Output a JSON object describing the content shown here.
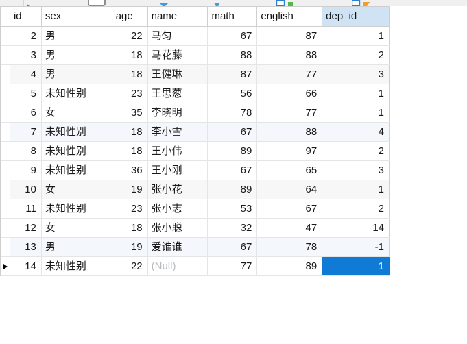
{
  "toolbar": {
    "icons": [
      {
        "name": "run-query-icon",
        "glyph": "▶"
      },
      {
        "name": "stop-icon",
        "glyph": "□"
      },
      {
        "name": "explain-icon",
        "glyph": "▸"
      },
      {
        "name": "filter-icon",
        "glyph": "▼"
      },
      {
        "name": "export-icon",
        "glyph": "▤"
      },
      {
        "name": "import-icon",
        "glyph": "▥"
      }
    ]
  },
  "grid": {
    "columns": [
      {
        "key": "id",
        "label": "id",
        "align": "num"
      },
      {
        "key": "sex",
        "label": "sex",
        "align": "txt"
      },
      {
        "key": "age",
        "label": "age",
        "align": "num"
      },
      {
        "key": "name",
        "label": "name",
        "align": "txt"
      },
      {
        "key": "math",
        "label": "math",
        "align": "num"
      },
      {
        "key": "english",
        "label": "english",
        "align": "num"
      },
      {
        "key": "dep_id",
        "label": "dep_id",
        "align": "num"
      }
    ],
    "selected_column": "dep_id",
    "selected_cell": {
      "row": 12,
      "column": "dep_id",
      "value": "1"
    },
    "current_row_index": 12,
    "null_text": "(Null)",
    "rows": [
      {
        "id": "2",
        "sex": "男",
        "age": "22",
        "name": "马匀",
        "math": "67",
        "english": "87",
        "dep_id": "1"
      },
      {
        "id": "3",
        "sex": "男",
        "age": "18",
        "name": "马花藤",
        "math": "88",
        "english": "88",
        "dep_id": "2"
      },
      {
        "id": "4",
        "sex": "男",
        "age": "18",
        "name": "王健琳",
        "math": "87",
        "english": "77",
        "dep_id": "3"
      },
      {
        "id": "5",
        "sex": "未知性别",
        "age": "23",
        "name": "王思葱",
        "math": "56",
        "english": "66",
        "dep_id": "1"
      },
      {
        "id": "6",
        "sex": "女",
        "age": "35",
        "name": "李晓明",
        "math": "78",
        "english": "77",
        "dep_id": "1"
      },
      {
        "id": "7",
        "sex": "未知性别",
        "age": "18",
        "name": "李小雪",
        "math": "67",
        "english": "88",
        "dep_id": "4"
      },
      {
        "id": "8",
        "sex": "未知性别",
        "age": "18",
        "name": "王小伟",
        "math": "89",
        "english": "97",
        "dep_id": "2"
      },
      {
        "id": "9",
        "sex": "未知性别",
        "age": "36",
        "name": "王小刚",
        "math": "67",
        "english": "65",
        "dep_id": "3"
      },
      {
        "id": "10",
        "sex": "女",
        "age": "19",
        "name": "张小花",
        "math": "89",
        "english": "64",
        "dep_id": "1"
      },
      {
        "id": "11",
        "sex": "未知性别",
        "age": "23",
        "name": "张小志",
        "math": "53",
        "english": "67",
        "dep_id": "2"
      },
      {
        "id": "12",
        "sex": "女",
        "age": "18",
        "name": "张小聪",
        "math": "32",
        "english": "47",
        "dep_id": "14"
      },
      {
        "id": "13",
        "sex": "男",
        "age": "19",
        "name": "爱谁谁",
        "math": "67",
        "english": "78",
        "dep_id": "-1"
      },
      {
        "id": "14",
        "sex": "未知性别",
        "age": "22",
        "name": null,
        "math": "77",
        "english": "89",
        "dep_id": "1"
      }
    ]
  },
  "colors": {
    "selection_blue": "#0f7bd4",
    "header_highlight": "#cfe3f5",
    "row_stripe_blue": "#f4f8fc",
    "row_stripe_gray": "#f7f7f7",
    "null_text": "#b6b9bd",
    "grid_line": "#e3e5e7"
  }
}
